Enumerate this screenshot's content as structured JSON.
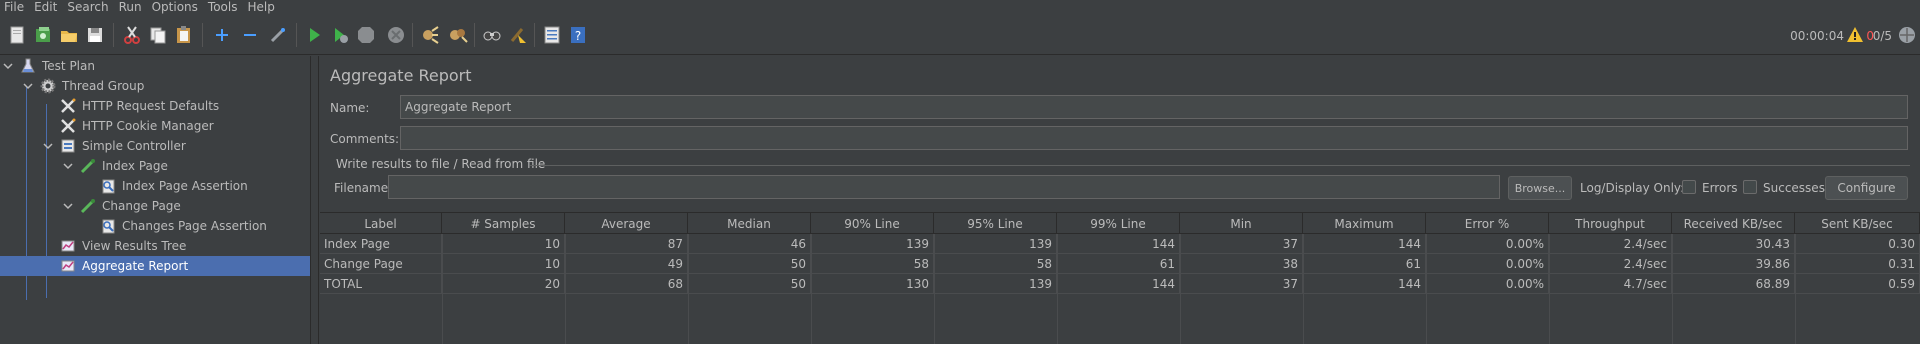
{
  "menu": [
    "File",
    "Edit",
    "Search",
    "Run",
    "Options",
    "Tools",
    "Help"
  ],
  "toolbar_icons": [
    "new-icon",
    "templates-icon",
    "open-icon",
    "save-icon",
    "cut-icon",
    "copy-icon",
    "paste-icon",
    "expand-icon",
    "collapse-icon",
    "toggle-icon",
    "start-icon",
    "start-no-pauses-icon",
    "stop-icon",
    "shutdown-icon",
    "clear-icon",
    "clear-all-icon",
    "search-icon",
    "reset-search-icon",
    "function-helper-icon",
    "help-icon"
  ],
  "status": {
    "time": "00:00:04",
    "errors": "0",
    "threads": "0/5"
  },
  "tree": [
    {
      "label": "Test Plan",
      "icon": "flask-icon",
      "expanded": true
    },
    {
      "label": "Thread Group",
      "icon": "gear-icon",
      "expanded": true
    },
    {
      "label": "HTTP Request Defaults",
      "icon": "wrench-icon"
    },
    {
      "label": "HTTP Cookie Manager",
      "icon": "wrench-icon"
    },
    {
      "label": "Simple Controller",
      "icon": "controller-icon",
      "expanded": true
    },
    {
      "label": "Index Page",
      "icon": "pipette-icon",
      "expanded": true
    },
    {
      "label": "Index Page Assertion",
      "icon": "assertion-icon"
    },
    {
      "label": "Change Page",
      "icon": "pipette-icon",
      "expanded": true
    },
    {
      "label": "Changes Page Assertion",
      "icon": "assertion-icon"
    },
    {
      "label": "View Results Tree",
      "icon": "chart-icon"
    },
    {
      "label": "Aggregate Report",
      "icon": "chart-icon",
      "selected": true
    }
  ],
  "panel": {
    "title": "Aggregate Report",
    "name_label": "Name:",
    "name_value": "Aggregate Report",
    "comments_label": "Comments:",
    "comments_value": "",
    "group_label": "Write results to file / Read from file",
    "filename_label": "Filename",
    "filename_value": "",
    "browse_label": "Browse...",
    "log_display_label": "Log/Display Only:",
    "errors_label": "Errors",
    "successes_label": "Successes",
    "configure_label": "Configure"
  },
  "table": {
    "columns": [
      "Label",
      "# Samples",
      "Average",
      "Median",
      "90% Line",
      "95% Line",
      "99% Line",
      "Min",
      "Maximum",
      "Error %",
      "Throughput",
      "Received KB/sec",
      "Sent KB/sec"
    ],
    "rows": [
      [
        "Index Page",
        "10",
        "87",
        "46",
        "139",
        "139",
        "144",
        "37",
        "144",
        "0.00%",
        "2.4/sec",
        "30.43",
        "0.30"
      ],
      [
        "Change Page",
        "10",
        "49",
        "50",
        "58",
        "58",
        "61",
        "38",
        "61",
        "0.00%",
        "2.4/sec",
        "39.86",
        "0.31"
      ],
      [
        "TOTAL",
        "20",
        "68",
        "50",
        "130",
        "139",
        "144",
        "37",
        "144",
        "0.00%",
        "4.7/sec",
        "68.89",
        "0.59"
      ]
    ]
  },
  "colors": {
    "background": "#3c3f41",
    "selection": "#4b6eaf",
    "text": "#bbbbbb",
    "error": "#ff5555"
  }
}
